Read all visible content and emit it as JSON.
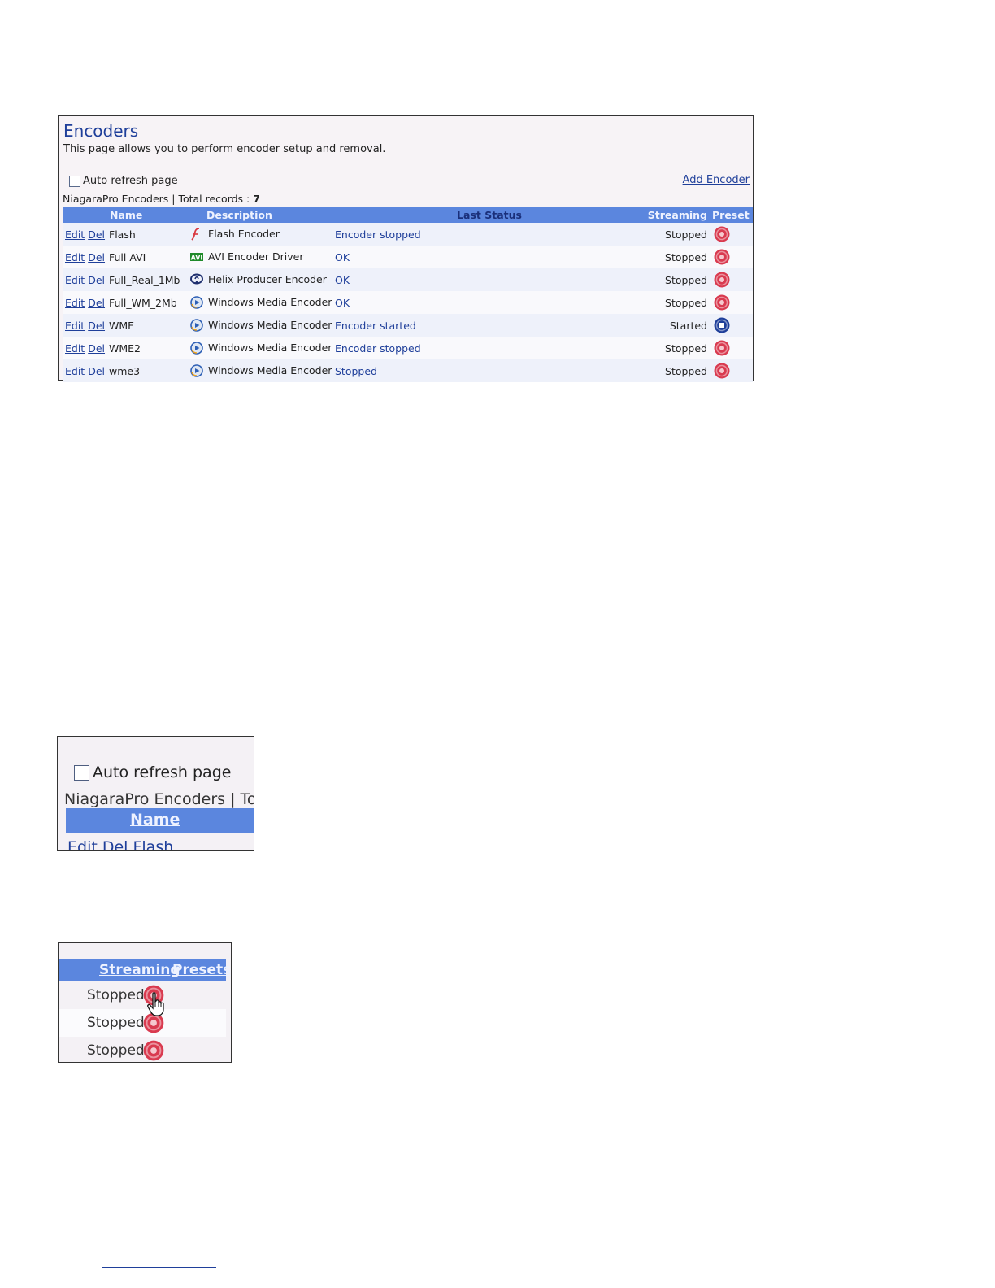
{
  "panel": {
    "title": "Encoders",
    "subtitle": "This page allows you to perform encoder setup and removal.",
    "auto_refresh_label": "Auto refresh page",
    "add_encoder_label": "Add Encoder",
    "records_label": "NiagaraPro Encoders | Total records : ",
    "records_count": "7"
  },
  "table": {
    "headers": {
      "name": "Name",
      "description": "Description",
      "last_status": "Last Status",
      "streaming": "Streaming",
      "preset": "Preset"
    },
    "edit_label": "Edit",
    "del_label": "Del",
    "rows": [
      {
        "name": "Flash",
        "icon": "flash-icon",
        "description": "Flash Encoder",
        "last_status": "Encoder stopped",
        "streaming": "Stopped",
        "state": "stopped"
      },
      {
        "name": "Full AVI",
        "icon": "avi-icon",
        "description": "AVI Encoder Driver",
        "last_status": "OK",
        "streaming": "Stopped",
        "state": "stopped"
      },
      {
        "name": "Full_Real_1Mb",
        "icon": "helix-icon",
        "description": "Helix Producer Encoder",
        "last_status": "OK",
        "streaming": "Stopped",
        "state": "stopped"
      },
      {
        "name": "Full_WM_2Mb",
        "icon": "windows-media-icon",
        "description": "Windows Media Encoder",
        "last_status": "OK",
        "streaming": "Stopped",
        "state": "stopped"
      },
      {
        "name": "WME",
        "icon": "windows-media-icon",
        "description": "Windows Media Encoder",
        "last_status": "Encoder started",
        "streaming": "Started",
        "state": "started"
      },
      {
        "name": "WME2",
        "icon": "windows-media-icon",
        "description": "Windows Media Encoder",
        "last_status": "Encoder stopped",
        "streaming": "Stopped",
        "state": "stopped"
      },
      {
        "name": "wme3",
        "icon": "windows-media-icon",
        "description": "Windows Media Encoder",
        "last_status": "Stopped",
        "streaming": "Stopped",
        "state": "stopped"
      }
    ]
  },
  "inset_refresh": {
    "auto_refresh_label": "Auto refresh page",
    "records_label": "NiagaraPro Encoders | Tota",
    "name_header": "Name",
    "row_text": "Edit Del Flash"
  },
  "inset_stream": {
    "streaming_header": "Streaming",
    "presets_header": "Presets",
    "rows": [
      "Stopped",
      "Stopped",
      "Stopped"
    ]
  },
  "colors": {
    "header_bar": "#5b86de",
    "link": "#1f3f9a",
    "stopped_button": "#d93a4f",
    "started_button": "#1f3f9a"
  }
}
